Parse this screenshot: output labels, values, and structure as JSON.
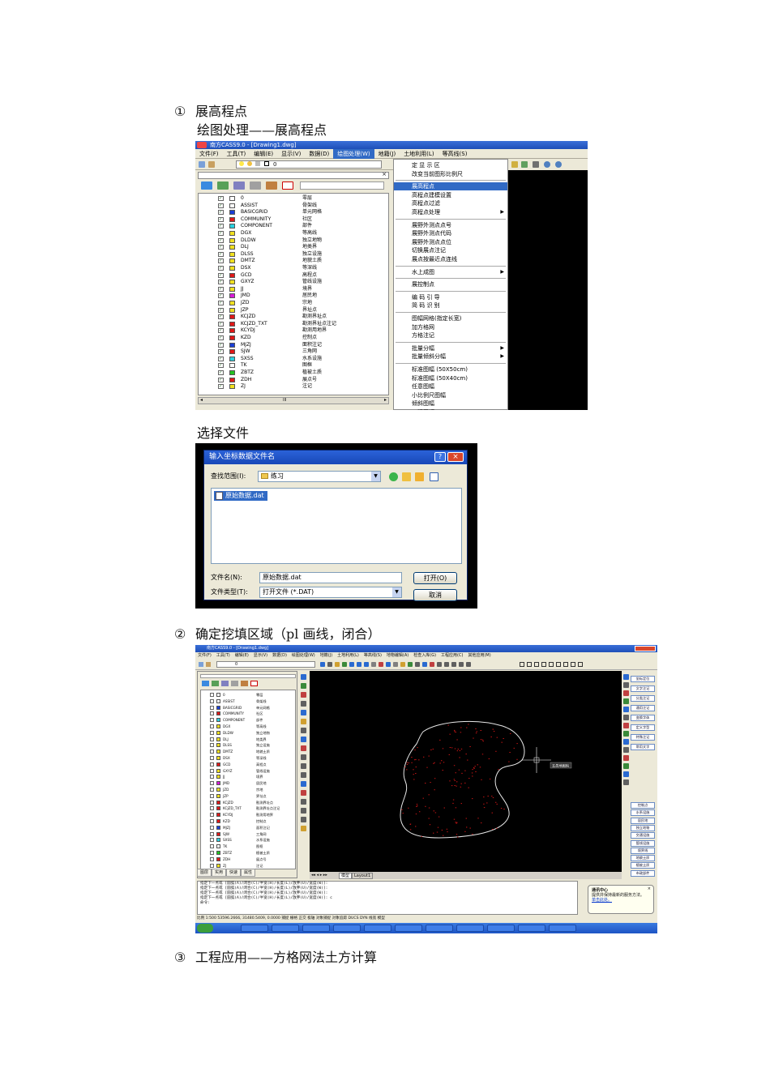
{
  "doc": {
    "step1_num": "①",
    "step1_title": "展高程点",
    "step1_sub": "绘图处理——展高程点",
    "choose_file": "选择文件",
    "step2_num": "②",
    "step2_title": "确定挖填区域（pl 画线，闭合）",
    "step3_num": "③",
    "step3_title": "工程应用——方格网法土方计算"
  },
  "shot1": {
    "window_title": "南方CASS9.0 - [Drawing1.dwg]",
    "menus": [
      "文件(F)",
      "工具(T)",
      "编辑(E)",
      "显示(V)",
      "数据(D)",
      "绘图处理(W)",
      "地籍(J)",
      "土地利用(L)",
      "等高线(S)"
    ],
    "active_menu": "绘图处理(W)",
    "layer_combo": "0",
    "layers": [
      {
        "name": "0",
        "desc": "零层",
        "color": "#ffffff"
      },
      {
        "name": "ASSIST",
        "desc": "骨架线",
        "color": "#ffffff"
      },
      {
        "name": "BASICGRID",
        "desc": "单元网格",
        "color": "#1a3fd6"
      },
      {
        "name": "COMMUNITY",
        "desc": "社区",
        "color": "#e01818"
      },
      {
        "name": "COMPONENT",
        "desc": "部件",
        "color": "#2ad1e0"
      },
      {
        "name": "DGX",
        "desc": "等高线",
        "color": "#f0e020"
      },
      {
        "name": "DLDW",
        "desc": "独立地物",
        "color": "#f0e020"
      },
      {
        "name": "DLJ",
        "desc": "地类界",
        "color": "#f0e020"
      },
      {
        "name": "DLSS",
        "desc": "独立设施",
        "color": "#f0e020"
      },
      {
        "name": "DMTZ",
        "desc": "地貌土质",
        "color": "#f0e020"
      },
      {
        "name": "DSX",
        "desc": "等深线",
        "color": "#f0e020"
      },
      {
        "name": "GCD",
        "desc": "高程点",
        "color": "#e01818"
      },
      {
        "name": "GXYZ",
        "desc": "管线设施",
        "color": "#f0e020"
      },
      {
        "name": "JJ",
        "desc": "境界",
        "color": "#f0e020"
      },
      {
        "name": "JMD",
        "desc": "居民地",
        "color": "#d81ad8"
      },
      {
        "name": "JZD",
        "desc": "宗地",
        "color": "#f0e020"
      },
      {
        "name": "JZP",
        "desc": "界址点",
        "color": "#f0e020"
      },
      {
        "name": "KCJZD",
        "desc": "勘测界址点",
        "color": "#e01818"
      },
      {
        "name": "KCJZD_TXT",
        "desc": "勘测界址点注记",
        "color": "#e01818"
      },
      {
        "name": "KCYDJ",
        "desc": "勘测用地界",
        "color": "#e01818"
      },
      {
        "name": "KZD",
        "desc": "控制点",
        "color": "#e01818"
      },
      {
        "name": "MJZJ",
        "desc": "面积注记",
        "color": "#1a3fd6"
      },
      {
        "name": "SJW",
        "desc": "三角网",
        "color": "#e01818"
      },
      {
        "name": "SXSS",
        "desc": "水系设施",
        "color": "#2ad1e0"
      },
      {
        "name": "TK",
        "desc": "图框",
        "color": "#ffffff"
      },
      {
        "name": "ZBTZ",
        "desc": "植被土质",
        "color": "#22c322"
      },
      {
        "name": "ZDH",
        "desc": "展点号",
        "color": "#e01818"
      },
      {
        "name": "ZJ",
        "desc": "注记",
        "color": "#f0e020"
      }
    ],
    "scroll_label": "III",
    "dropdown": [
      {
        "label": "定 显 示 区",
        "sub": false
      },
      {
        "label": "改变当前图形比例尺",
        "sub": false
      },
      {
        "sep": true
      },
      {
        "label": "展高程点",
        "sub": false,
        "selected": true
      },
      {
        "label": "高程点建模设置",
        "sub": false
      },
      {
        "label": "高程点过滤",
        "sub": false
      },
      {
        "label": "高程点处理",
        "sub": true
      },
      {
        "sep": true
      },
      {
        "label": "展野外测点点号",
        "sub": false
      },
      {
        "label": "展野外测点代码",
        "sub": false
      },
      {
        "label": "展野外测点点位",
        "sub": false
      },
      {
        "label": "切换展点注记",
        "sub": false
      },
      {
        "label": "展点按最近点连线",
        "sub": false
      },
      {
        "sep": true
      },
      {
        "label": "水上成图",
        "sub": true
      },
      {
        "sep": true
      },
      {
        "label": "展控制点",
        "sub": false
      },
      {
        "sep": true
      },
      {
        "label": "编 码 引 导",
        "sub": false
      },
      {
        "label": "简 码 识 别",
        "sub": false
      },
      {
        "sep": true
      },
      {
        "label": "图幅网格(指定长宽)",
        "sub": false
      },
      {
        "label": "加方格网",
        "sub": false
      },
      {
        "label": "方格注记",
        "sub": false
      },
      {
        "sep": true
      },
      {
        "label": "批量分幅",
        "sub": true
      },
      {
        "label": "批量倾斜分幅",
        "sub": true
      },
      {
        "sep": true
      },
      {
        "label": "标准图幅 (50X50cm)",
        "sub": false
      },
      {
        "label": "标准图幅 (50X40cm)",
        "sub": false
      },
      {
        "label": "任意图幅",
        "sub": false
      },
      {
        "label": "小比例尺图幅",
        "sub": false
      },
      {
        "label": "倾斜图幅",
        "sub": false
      },
      {
        "label": "工程图幅",
        "sub": true
      }
    ]
  },
  "shot2": {
    "title": "输入坐标数据文件名",
    "help": "?",
    "close": "×",
    "lookin_label": "查找范围(I):",
    "lookin_value": "练习",
    "file_item": "原始数据.dat",
    "filename_label": "文件名(N):",
    "filename_value": "原始数据.dat",
    "filetype_label": "文件类型(T):",
    "filetype_value": "打开文件 (*.DAT)",
    "open_button": "打开(O)",
    "cancel_button": "取消"
  },
  "shot3": {
    "window_title": "南方CASS9.0 - [Drawing1.dwg]",
    "menus": [
      "文件(F)",
      "工具(T)",
      "编辑(E)",
      "显示(V)",
      "数据(D)",
      "绘图处理(W)",
      "地籍(J)",
      "土地利用(L)",
      "等高线(S)",
      "地物编辑(A)",
      "检查入库(G)",
      "工程应用(C)",
      "其他应用(M)"
    ],
    "layer_combo": "0",
    "layers": [
      {
        "name": "0",
        "desc": "零层",
        "color": "#ffffff"
      },
      {
        "name": "ASSIST",
        "desc": "骨架线",
        "color": "#ffffff"
      },
      {
        "name": "BASICGRID",
        "desc": "单元网格",
        "color": "#1a3fd6"
      },
      {
        "name": "COMMUNITY",
        "desc": "社区",
        "color": "#e01818"
      },
      {
        "name": "COMPONENT",
        "desc": "部件",
        "color": "#2ad1e0"
      },
      {
        "name": "DGX",
        "desc": "等高线",
        "color": "#f0e020"
      },
      {
        "name": "DLDW",
        "desc": "独立地物",
        "color": "#f0e020"
      },
      {
        "name": "DLJ",
        "desc": "地类界",
        "color": "#f0e020"
      },
      {
        "name": "DLSS",
        "desc": "独立设施",
        "color": "#f0e020"
      },
      {
        "name": "DMTZ",
        "desc": "地貌土质",
        "color": "#f0e020"
      },
      {
        "name": "DSX",
        "desc": "等深线",
        "color": "#f0e020"
      },
      {
        "name": "GCD",
        "desc": "高程点",
        "color": "#e01818"
      },
      {
        "name": "GXYZ",
        "desc": "管线设施",
        "color": "#f0e020"
      },
      {
        "name": "JJ",
        "desc": "境界",
        "color": "#f0e020"
      },
      {
        "name": "JMD",
        "desc": "居民地",
        "color": "#d81ad8"
      },
      {
        "name": "JZD",
        "desc": "宗地",
        "color": "#f0e020"
      },
      {
        "name": "JZP",
        "desc": "界址点",
        "color": "#f0e020"
      },
      {
        "name": "KCJZD",
        "desc": "勘测界址点",
        "color": "#e01818"
      },
      {
        "name": "KCJZD_TXT",
        "desc": "勘测界址点注记",
        "color": "#e01818"
      },
      {
        "name": "KCYDJ",
        "desc": "勘测用地界",
        "color": "#e01818"
      },
      {
        "name": "KZD",
        "desc": "控制点",
        "color": "#e01818"
      },
      {
        "name": "MJZJ",
        "desc": "面积注记",
        "color": "#1a3fd6"
      },
      {
        "name": "SJW",
        "desc": "三角网",
        "color": "#e01818"
      },
      {
        "name": "SXSS",
        "desc": "水系设施",
        "color": "#2ad1e0"
      },
      {
        "name": "TK",
        "desc": "图框",
        "color": "#ffffff"
      },
      {
        "name": "ZBTZ",
        "desc": "植被土质",
        "color": "#22c322"
      },
      {
        "name": "ZDH",
        "desc": "展点号",
        "color": "#e01818"
      },
      {
        "name": "ZJ",
        "desc": "注记",
        "color": "#f0e020"
      }
    ],
    "panel_tabs": [
      "图层",
      "实用",
      "快速",
      "属性"
    ],
    "right_top": [
      "坐标定位",
      "文字注记",
      "分类注记",
      "通用注记",
      "变换字体",
      "定义字型",
      "特殊注记",
      "常用文字"
    ],
    "right_bottom": [
      "控制点",
      "水系设施",
      "居民地",
      "独立地物",
      "交通设施",
      "管线设施",
      "境界线",
      "地貌土质",
      "植被土质",
      "市政部件"
    ],
    "canvas_tooltip": "五邑地图码",
    "layout_tabs": [
      "模型",
      "Layout1"
    ],
    "command_lines": [
      "指定下一点或 [圆弧(A)/闭合(C)/半宽(H)/长度(L)/放弃(U)/宽度(W)]:",
      "指定下一点或 [圆弧(A)/闭合(C)/半宽(H)/长度(L)/放弃(U)/宽度(W)]:",
      "指定下一点或 [圆弧(A)/闭合(C)/半宽(H)/长度(L)/放弃(U)/宽度(W)]:",
      "指定下一点或 [圆弧(A)/闭合(C)/半宽(H)/长度(L)/放弃(U)/宽度(W)]: c",
      "命令:"
    ],
    "status_text": "比例 1:500  53596.2666, 31480.5409, 0.0000     捕捉 栅格 正交 极轴 对象捕捉 对象追踪 DUCS DYN 线宽 模型",
    "notify_title": "通讯中心",
    "notify_body": "提供并保持最新的服务方法。",
    "notify_link": "单击此处。"
  },
  "colors": {
    "menu_highlight": "#316ac5",
    "canvas_bg": "#000000",
    "boundary": "#e8e8e8",
    "points": "#e01818"
  }
}
